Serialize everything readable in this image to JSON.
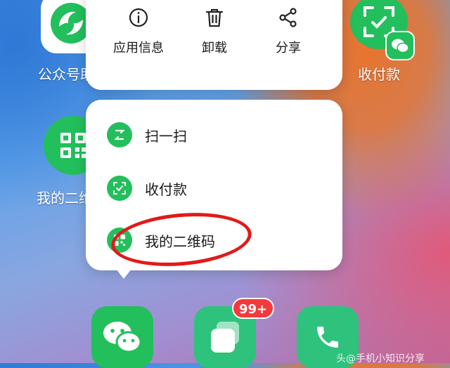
{
  "home_apps": {
    "official_accounts": {
      "label": "公众号助"
    },
    "pay": {
      "label": "收付款"
    },
    "my_qrcode": {
      "label": "我的二维"
    }
  },
  "quick_actions": [
    {
      "label": "应用信息",
      "icon": "info-icon"
    },
    {
      "label": "卸载",
      "icon": "trash-icon"
    },
    {
      "label": "分享",
      "icon": "share-icon"
    }
  ],
  "shortcut_menu": [
    {
      "label": "扫一扫",
      "icon": "scan-icon"
    },
    {
      "label": "收付款",
      "icon": "pay-icon"
    },
    {
      "label": "我的二维码",
      "icon": "qrcode-icon"
    }
  ],
  "dock": {
    "badge": "99+"
  },
  "watermark": "头@手机小知识分享",
  "colors": {
    "wechat_green": "#22bf5c",
    "highlight_red": "#e11a1a",
    "badge_red": "#f23a3c"
  }
}
